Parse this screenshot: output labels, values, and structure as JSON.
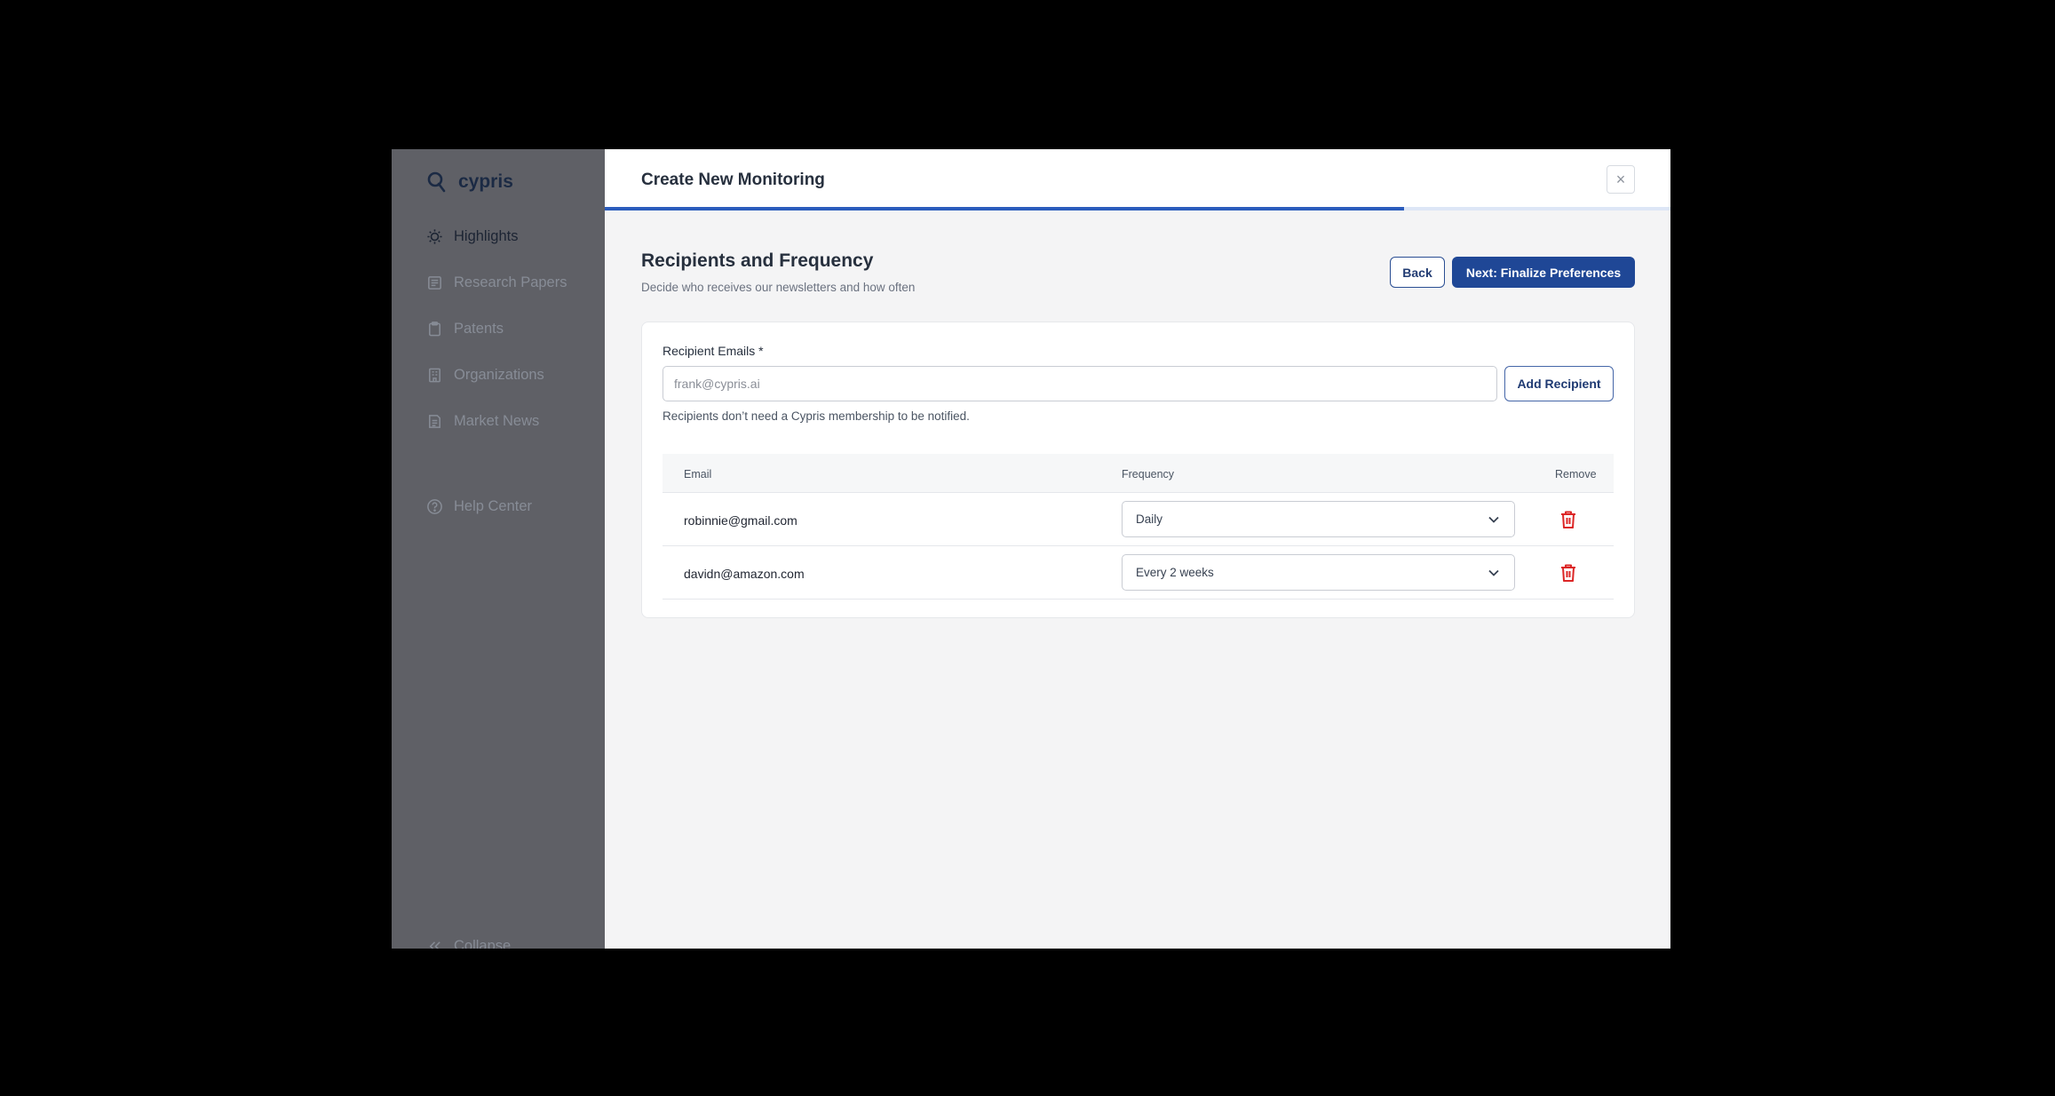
{
  "brand": {
    "name": "cypris"
  },
  "sidebar": {
    "items": [
      {
        "label": "Highlights",
        "icon": "lightbulb-icon"
      },
      {
        "label": "Research Papers",
        "icon": "document-icon"
      },
      {
        "label": "Patents",
        "icon": "clipboard-icon"
      },
      {
        "label": "Organizations",
        "icon": "building-icon"
      },
      {
        "label": "Market News",
        "icon": "news-icon"
      }
    ],
    "help": {
      "label": "Help Center",
      "icon": "question-circle-icon"
    },
    "collapse": {
      "label": "Collapse",
      "icon": "double-chevron-left-icon"
    }
  },
  "modal": {
    "title": "Create New Monitoring",
    "close_glyph": "×",
    "progress": 0.75,
    "step_title": "Recipients and Frequency",
    "step_subtitle": "Decide who receives our newsletters and how often",
    "back_label": "Back",
    "next_label": "Next: Finalize Preferences"
  },
  "form": {
    "label": "Recipient Emails *",
    "placeholder": "frank@cypris.ai",
    "add_label": "Add Recipient",
    "helper": "Recipients don’t need a Cypris membership to be notified."
  },
  "table": {
    "headers": {
      "email": "Email",
      "frequency": "Frequency",
      "remove": "Remove"
    },
    "rows": [
      {
        "email": "robinnie@gmail.com",
        "frequency": "Daily"
      },
      {
        "email": "davidn@amazon.com",
        "frequency": "Every 2 weeks"
      }
    ]
  },
  "colors": {
    "accent": "#1f4796",
    "danger": "#dc2626",
    "sidebar": "#5f6066"
  }
}
